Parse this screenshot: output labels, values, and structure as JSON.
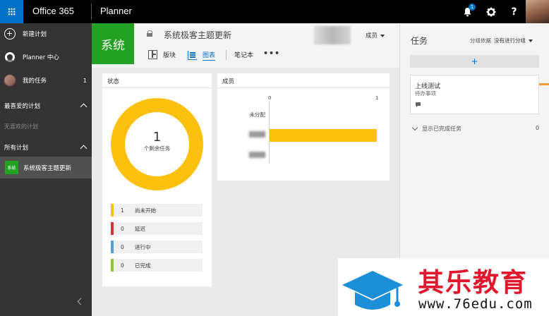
{
  "topbar": {
    "brand": "Office 365",
    "app_name": "Planner",
    "notification_count": "1",
    "help_label": "?"
  },
  "sidebar": {
    "new_plan": "新建计划",
    "hub": "Planner 中心",
    "my_tasks": "我的任务",
    "my_tasks_count": "1",
    "favorites_header": "最喜爱的计划",
    "favorites_empty": "无喜欢的计划",
    "all_plans_header": "所有计划",
    "active_plan_badge": "系统",
    "active_plan": "系统极客主题更新"
  },
  "plan_header": {
    "logo_text": "系统",
    "title": "系统极客主题更新",
    "members_label": "成员",
    "tabs": [
      {
        "label": "版块",
        "icon": "board-icon"
      },
      {
        "label": "图表",
        "icon": "chart-icon"
      },
      {
        "label": "笔记本"
      }
    ],
    "more_label": "•••"
  },
  "status_card": {
    "title": "状态",
    "remaining_count": "1",
    "remaining_label": "个剩余任务",
    "legend": [
      {
        "count": "1",
        "label": "尚未开始",
        "color": "#fcc10f"
      },
      {
        "count": "0",
        "label": "延迟",
        "color": "#d13438"
      },
      {
        "count": "0",
        "label": "进行中",
        "color": "#4f9fdc"
      },
      {
        "count": "0",
        "label": "已完成",
        "color": "#8dc63f"
      }
    ]
  },
  "chart_data": {
    "type": "bar",
    "title": "成员",
    "categories": [
      "未分配",
      "",
      ""
    ],
    "values": [
      0,
      1,
      0
    ],
    "xlim": [
      0,
      1
    ],
    "x_ticks": [
      "0",
      "1"
    ],
    "bar_color": "#fcc10f"
  },
  "tasks_panel": {
    "title": "任务",
    "group_by_label": "分组依据",
    "group_by_value": "没有进行分组",
    "add_label": "+",
    "task": {
      "title": "上线测试",
      "bucket": "待办事项"
    },
    "show_completed": "显示已完成任务",
    "completed_count": "0"
  },
  "watermark": {
    "main": "其乐教育",
    "url": "www.76edu.com"
  }
}
